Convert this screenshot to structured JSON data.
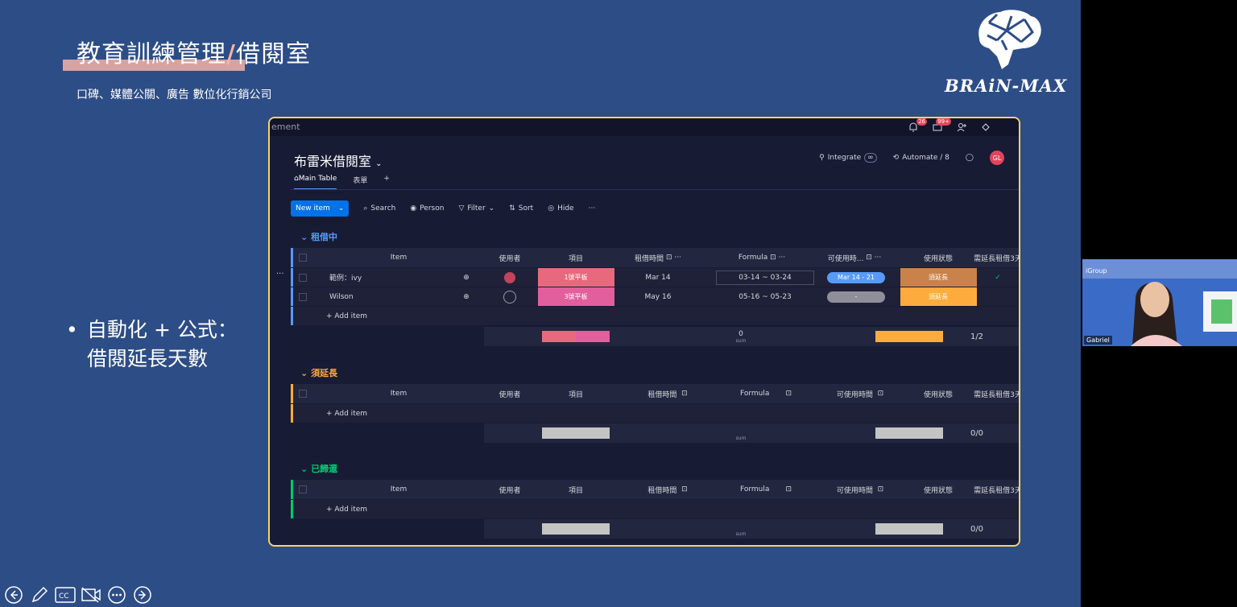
{
  "slide": {
    "title_main": "教育訓練管理",
    "title_slash": "/",
    "title_rest": "借閱室",
    "subtitle": "口碑、媒體公關、廣告 數位化行銷公司",
    "logo_text": "BRAiN-MAX",
    "bullet_dot": "•",
    "bullet_line1": "自動化 + 公式：",
    "bullet_line2": "借閱延長天數",
    "colors": {
      "background": "#2d4d86",
      "accent": "#f4b3a7",
      "frame": "#f6d36b"
    }
  },
  "app": {
    "crumb": "ement",
    "notif_badge": "26",
    "inbox_badge": "99+",
    "board_title": "布雷米借閱室",
    "tabs": [
      "Main Table",
      "表單",
      "+"
    ],
    "integrate": "Integrate",
    "automate": "Automate / 8",
    "avatar": "GL",
    "toolbar": {
      "new_item": "New item",
      "search": "Search",
      "person": "Person",
      "filter": "Filter",
      "sort": "Sort",
      "hide": "Hide",
      "more": "···"
    },
    "columns": [
      "Item",
      "使用者",
      "項目",
      "租借時間",
      "Formula",
      "可使用時...",
      "使用狀態",
      "需延長租借3天"
    ],
    "columns_full": [
      "Item",
      "使用者",
      "項目",
      "租借時間",
      "Formula",
      "可使用時間",
      "使用狀態",
      "需延長租借3天"
    ],
    "add_item": "+ Add item",
    "sum_label": "sum",
    "groups": [
      {
        "label": "租借中",
        "color": "#579bfc",
        "rows": [
          {
            "item": "範例：ivy",
            "device": "1號平板",
            "rent": "Mar 14",
            "formula": "03-14 ~ 03-24",
            "avail": "Mar 14 - 21",
            "status": "須延長",
            "check": "✓"
          },
          {
            "item": "Wilson",
            "device": "3號平板",
            "rent": "May 16",
            "formula": "05-16 ~ 05-23",
            "avail": "-",
            "status": "須延長",
            "check": ""
          }
        ],
        "sum_value": "0",
        "count": "1/2"
      },
      {
        "label": "須延長",
        "color": "#fdab3d",
        "count": "0/0"
      },
      {
        "label": "已歸還",
        "color": "#00c875",
        "count": "0/0"
      }
    ]
  },
  "webcam": {
    "name": "Gabriel",
    "brand": "iGroup"
  },
  "controls": [
    "back-icon",
    "pen-icon",
    "captions-icon",
    "camera-off-icon",
    "more-icon",
    "forward-icon"
  ]
}
